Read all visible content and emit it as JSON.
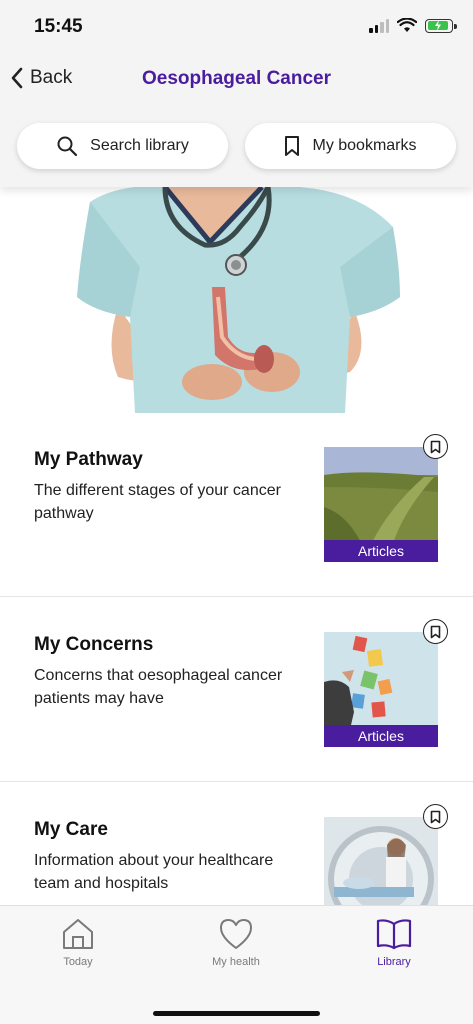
{
  "status_bar": {
    "time": "15:45"
  },
  "header": {
    "back_label": "Back",
    "title": "Oesophageal Cancer",
    "search_label": "Search library",
    "bookmarks_label": "My bookmarks"
  },
  "sections": [
    {
      "title": "My Pathway",
      "description": "The different stages of your cancer pathway",
      "badge": "Articles"
    },
    {
      "title": "My Concerns",
      "description": "Concerns that oesophageal cancer patients may have",
      "badge": "Articles"
    },
    {
      "title": "My Care",
      "description": "Information about your healthcare team and hospitals"
    }
  ],
  "tabbar": {
    "tabs": [
      {
        "label": "Today",
        "icon": "home-icon"
      },
      {
        "label": "My health",
        "icon": "heart-icon"
      },
      {
        "label": "Library",
        "icon": "book-icon",
        "active": true
      }
    ]
  },
  "colors": {
    "brand_purple": "#4a1d9e",
    "battery_green": "#3ac24b"
  }
}
